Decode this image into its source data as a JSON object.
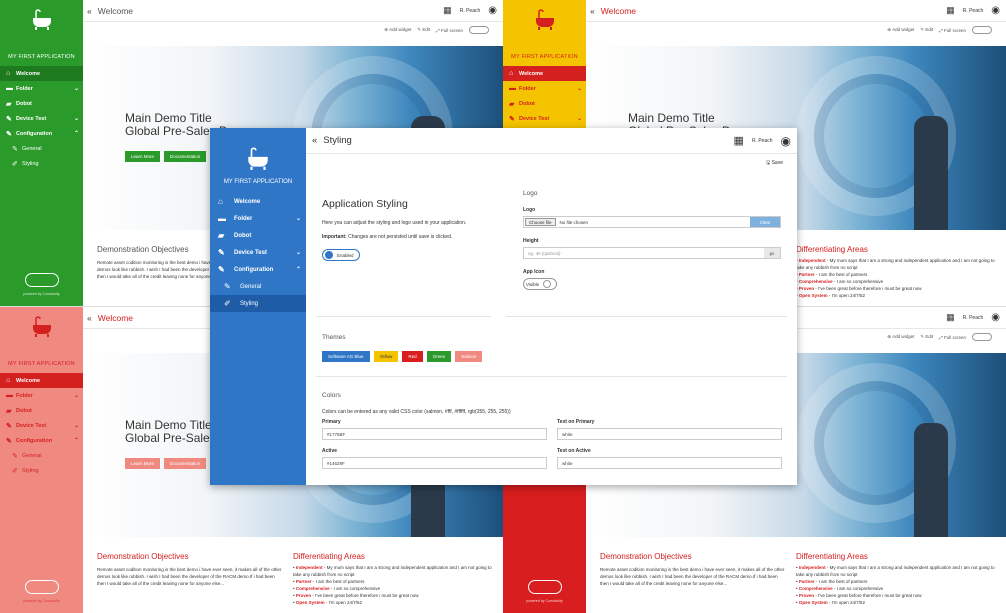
{
  "app_name": "MY FIRST APPLICATION",
  "powered": "powered by Cumulocity",
  "user": "R. Peach",
  "header": {
    "title": "Welcome"
  },
  "toolbar": {
    "add_widget": "Add widget",
    "edit": "Edit",
    "full_screen": "Full screen"
  },
  "nav": {
    "welcome": "Welcome",
    "folder": "Folder",
    "dobot": "Dobot",
    "device_test": "Device Test",
    "configuration": "Configuration",
    "general": "General",
    "styling": "Styling"
  },
  "hero": {
    "title": "Main Demo Title",
    "subtitle": "Global Pre-Sales Demo",
    "learn_more": "Learn More",
    "documentation": "Documentation"
  },
  "objectives": {
    "title": "Demonstration Objectives",
    "text": "Remote asset codition monitoring is the best demo i have ever seen, it makes all of the other demos look like rubbish. I wish I had been the developer of the RACM demo.If i had been then I would take all of the credit leaving none for anyone else..."
  },
  "differentiating": {
    "title": "Differentiating Areas",
    "items": [
      {
        "k": "Independent",
        "v": " - My mum says that I am a strong and independent application and I am not going to take any rubbish from no script"
      },
      {
        "k": "Partner",
        "v": " - I am the best of partners"
      },
      {
        "k": "Comprehensive",
        "v": " - I am so comprehensive"
      },
      {
        "k": "Proven",
        "v": " - I've been great before therefore i must be great now"
      },
      {
        "k": "Open System",
        "v": " - I'm open 24/7/52"
      }
    ]
  },
  "theme_colors": {
    "green": "#2a9a2a",
    "yellow": "#f5c400",
    "red": "#d81e1e",
    "salmon": "#f08a80",
    "blue": "#2f77c6"
  },
  "modal": {
    "header": "Styling",
    "save": "Save",
    "styling_title": "Application Styling",
    "styling_desc": "Here you can adjust the styling and logo used in your application.",
    "important_label": "Important:",
    "important_text": " Changes are not persisted until save is clicked.",
    "enabled": "Enabled",
    "logo_title": "Logo",
    "logo_label": "Logo",
    "choose_file": "Choose file",
    "no_file": "No file chosen",
    "clear": "Clear",
    "height_label": "Height",
    "height_placeholder": "eg. 40 (optional)",
    "px": "px",
    "app_icon_label": "App Icon",
    "visible": "Visible",
    "themes_title": "Themes",
    "themes": [
      "Software AG Blue",
      "Yellow",
      "Red",
      "Green",
      "Salmon"
    ],
    "colors_title": "Colors",
    "colors_desc": "Colors can be entered as any valid CSS color (salmon, #fff, #ffffff, rgb(255, 255, 255))",
    "primary_label": "Primary",
    "primary_value": "#1776BF",
    "text_on_primary_label": "Text on Primary",
    "text_on_primary_value": "white",
    "active_label": "Active",
    "active_value": "#14629F",
    "text_on_active_label": "Text on Active",
    "text_on_active_value": "white"
  }
}
